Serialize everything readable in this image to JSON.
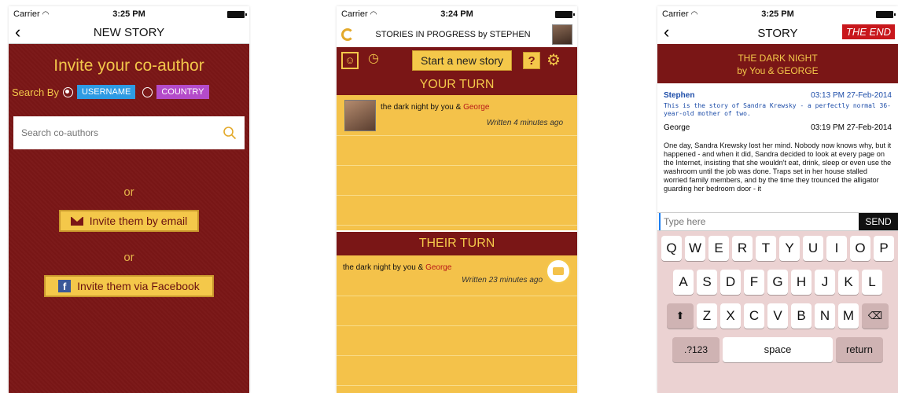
{
  "status": {
    "carrier": "Carrier",
    "time1": "3:25 PM",
    "time2": "3:24 PM",
    "time3": "3:25 PM"
  },
  "screen1": {
    "nav_title": "NEW STORY",
    "invite_title": "Invite your co-author",
    "search_by": "Search By",
    "option_username": "USERNAME",
    "option_country": "COUNTRY",
    "search_placeholder": "Search co-authors",
    "or1": "or",
    "or2": "or",
    "email_button": "Invite them by email",
    "facebook_button": "Invite them via Facebook",
    "colors": {
      "background": "#7a1616",
      "accent": "#f4c84a",
      "username_pill": "#2e9be3",
      "country_pill": "#b44bc9"
    }
  },
  "screen2": {
    "title": "STORIES IN PROGRESS by STEPHEN",
    "start_button": "Start a new story",
    "help_label": "?",
    "your_turn": "YOUR TURN",
    "their_turn": "THEIR TURN",
    "your_story": {
      "title": "the dark night by you & ",
      "coauthor": "George",
      "written": "Written 4 minutes ago"
    },
    "their_story": {
      "title": "the dark night by you & ",
      "coauthor": "George",
      "written": "Written 23 minutes ago"
    }
  },
  "screen3": {
    "nav_title": "STORY",
    "the_end": "THE END",
    "banner_line1": "THE DARK NIGHT",
    "banner_line2": "by You & GEORGE",
    "messages": [
      {
        "author": "Stephen",
        "time": "03:13 PM 27-Feb-2014",
        "text": "This is the story of Sandra Krewsky - a perfectly normal 36-year-old mother of two."
      },
      {
        "author": "George",
        "time": "03:19 PM 27-Feb-2014",
        "text": "One day, Sandra Krewsky lost her mind. Nobody now knows why, but it happened - and when it did, Sandra decided to look at every page on the Internet, insisting that she wouldn't eat, drink, sleep or even use the washroom until the job was done. Traps set in her house stalled worried family members, and by the time they trounced the alligator guarding her bedroom door - it"
      }
    ],
    "input_placeholder": "Type here",
    "send_button": "SEND",
    "keyboard": {
      "row1": [
        "Q",
        "W",
        "E",
        "R",
        "T",
        "Y",
        "U",
        "I",
        "O",
        "P"
      ],
      "row2": [
        "A",
        "S",
        "D",
        "F",
        "G",
        "H",
        "J",
        "K",
        "L"
      ],
      "row3": [
        "Z",
        "X",
        "C",
        "V",
        "B",
        "N",
        "M"
      ],
      "numbers": ".?123",
      "space": "space",
      "return": "return"
    }
  }
}
